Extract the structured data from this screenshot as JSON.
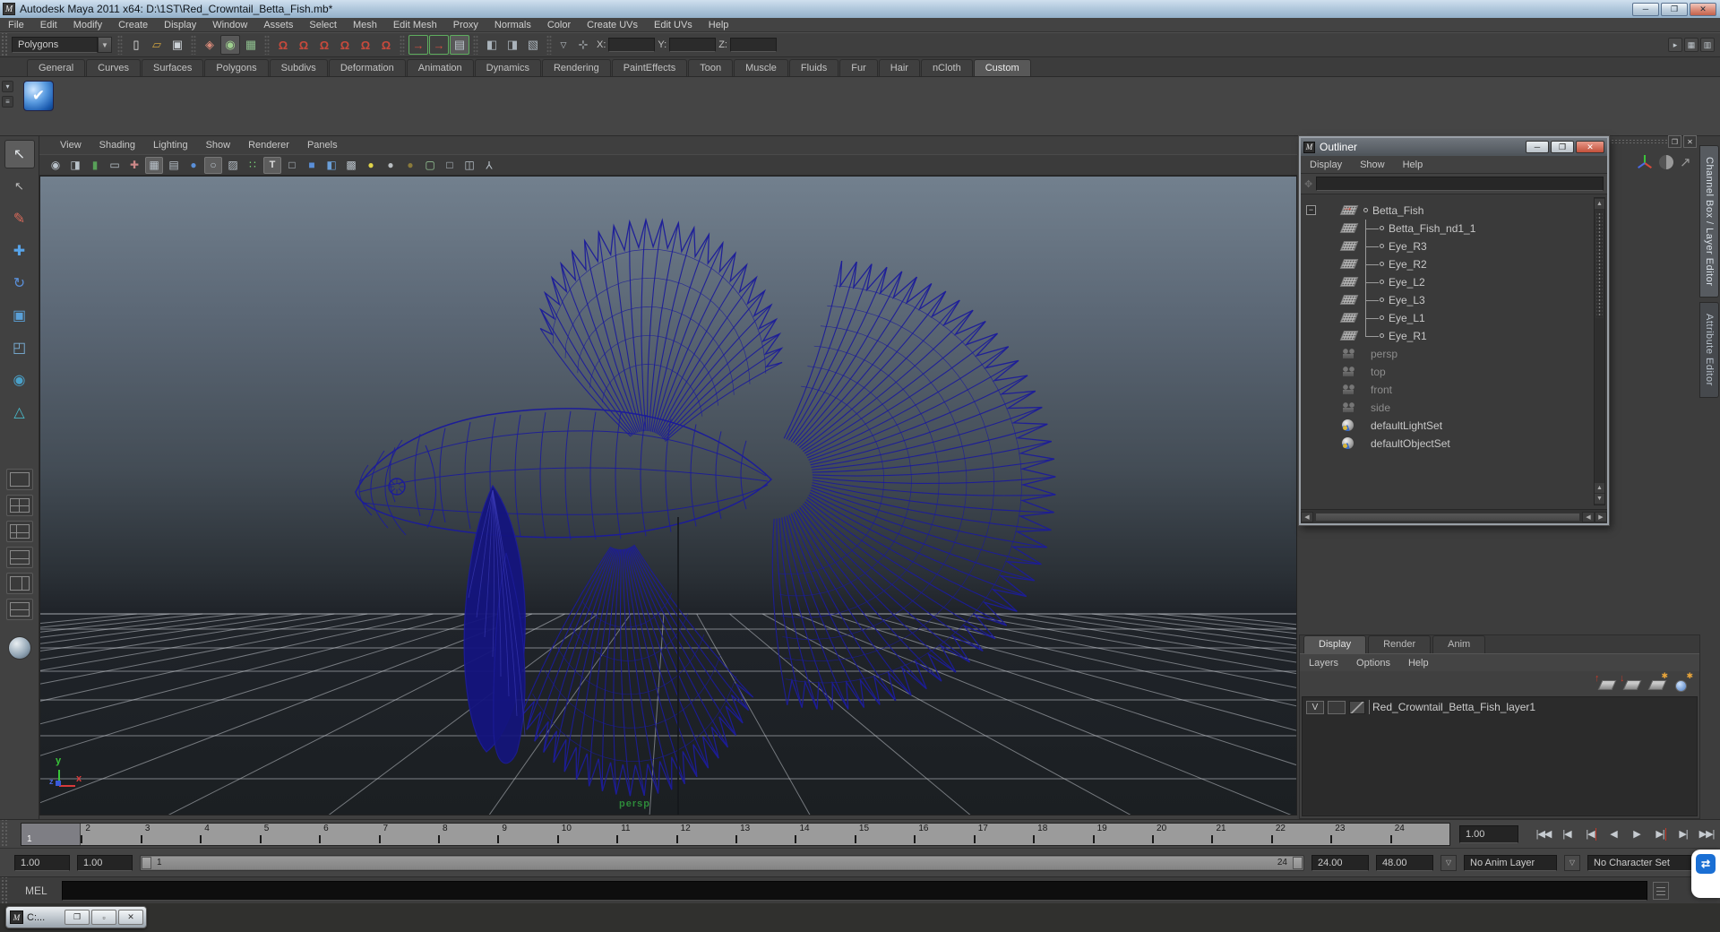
{
  "window": {
    "title": "Autodesk Maya 2011 x64: D:\\1ST\\Red_Crowntail_Betta_Fish.mb*",
    "minimize": "─",
    "maximize": "❐",
    "close": "✕"
  },
  "menubar": {
    "items": [
      "File",
      "Edit",
      "Modify",
      "Create",
      "Display",
      "Window",
      "Assets",
      "Select",
      "Mesh",
      "Edit Mesh",
      "Proxy",
      "Normals",
      "Color",
      "Create UVs",
      "Edit UVs",
      "Help"
    ]
  },
  "statusline": {
    "mode": "Polygons",
    "file_icons": [
      {
        "name": "new-scene"
      },
      {
        "name": "open-scene"
      },
      {
        "name": "save-scene"
      }
    ],
    "select_icons": [
      {
        "name": "select-hierarchy"
      },
      {
        "name": "select-object",
        "active": true
      },
      {
        "name": "select-component"
      }
    ],
    "snap_icons": [
      {
        "name": "snap-grid"
      },
      {
        "name": "snap-curve"
      },
      {
        "name": "snap-point"
      },
      {
        "name": "snap-projected-center"
      },
      {
        "name": "snap-view-plane"
      },
      {
        "name": "make-live"
      }
    ],
    "history_icons": [
      {
        "name": "input-connections"
      },
      {
        "name": "output-connections"
      },
      {
        "name": "construction-history",
        "active": true
      }
    ],
    "render_icons": [
      {
        "name": "render-current-frame"
      },
      {
        "name": "ipr-render"
      },
      {
        "name": "render-settings"
      }
    ],
    "coords": [
      {
        "label": "X:"
      },
      {
        "label": "Y:"
      },
      {
        "label": "Z:"
      }
    ]
  },
  "shelf": {
    "tabs": [
      {
        "label": "General"
      },
      {
        "label": "Curves"
      },
      {
        "label": "Surfaces"
      },
      {
        "label": "Polygons"
      },
      {
        "label": "Subdivs"
      },
      {
        "label": "Deformation"
      },
      {
        "label": "Animation"
      },
      {
        "label": "Dynamics"
      },
      {
        "label": "Rendering"
      },
      {
        "label": "PaintEffects"
      },
      {
        "label": "Toon"
      },
      {
        "label": "Muscle"
      },
      {
        "label": "Fluids"
      },
      {
        "label": "Fur"
      },
      {
        "label": "Hair"
      },
      {
        "label": "nCloth"
      },
      {
        "label": "Custom",
        "active": true
      }
    ],
    "item_check": "✔"
  },
  "toolbox": {
    "tools": [
      {
        "name": "select-tool",
        "cls": "t-select",
        "active": true
      },
      {
        "name": "lasso-select-tool",
        "cls": "t-lasso"
      },
      {
        "name": "paint-select-tool",
        "cls": "t-paint"
      },
      {
        "name": "move-tool",
        "cls": "t-move"
      },
      {
        "name": "rotate-tool",
        "cls": "t-rotate"
      },
      {
        "name": "scale-tool",
        "cls": "t-scale"
      },
      {
        "name": "universal-manipulator-tool",
        "cls": "t-univ"
      },
      {
        "name": "soft-modification-tool",
        "cls": "t-soft"
      },
      {
        "name": "show-manipulator-tool",
        "cls": "t-showman"
      }
    ],
    "layouts": [
      {
        "name": "layout-single-pane",
        "cls": "lay-single"
      },
      {
        "name": "layout-four-pane",
        "cls": "lay-four"
      },
      {
        "name": "layout-pane-left-split",
        "cls": "lay-pane-left-split"
      },
      {
        "name": "layout-pane-bottom-split",
        "cls": "lay-pane-bottom-split"
      },
      {
        "name": "layout-two-pane-side",
        "cls": "lay-two-pane-side"
      },
      {
        "name": "layout-hypergraph-persp",
        "cls": "lay-hypergraph-persp"
      }
    ]
  },
  "viewport": {
    "menus": [
      "View",
      "Shading",
      "Lighting",
      "Show",
      "Renderer",
      "Panels"
    ],
    "toolbar": [
      {
        "name": "select-camera"
      },
      {
        "name": "camera-attributes"
      },
      {
        "name": "bookmarks"
      },
      {
        "name": "image-plane"
      },
      {
        "name": "camera-manipulator"
      },
      {
        "name": "wireframe",
        "sel": true
      },
      {
        "name": "film-gate"
      },
      {
        "name": "shaded"
      },
      {
        "name": "flat-shade",
        "sel": true
      },
      {
        "name": "xray"
      },
      {
        "name": "vertex-dots"
      },
      {
        "name": "textured",
        "sel": true
      },
      {
        "name": "default-material"
      },
      {
        "name": "shaded-cube"
      },
      {
        "name": "textured-cube"
      },
      {
        "name": "checker-sphere"
      },
      {
        "name": "lighting-all"
      },
      {
        "name": "lighting-default"
      },
      {
        "name": "lighting-none"
      },
      {
        "name": "isolate-select"
      },
      {
        "name": "plugin-cube"
      },
      {
        "name": "plugin-cube2"
      },
      {
        "name": "share-view"
      }
    ],
    "camera_label": "persp",
    "axis": {
      "x": "x",
      "y": "y",
      "z": "z"
    }
  },
  "outliner": {
    "title": "Outliner",
    "buttons": {
      "minimize": "─",
      "restore": "❐",
      "close": "✕"
    },
    "menus": [
      "Display",
      "Show",
      "Help"
    ],
    "search_value": "",
    "items": [
      {
        "label": "Betta_Fish",
        "cls": "root",
        "icon": "xform"
      },
      {
        "label": "Betta_Fish_nd1_1",
        "cls": "child",
        "icon": "mesh"
      },
      {
        "label": "Eye_R3",
        "cls": "child",
        "icon": "mesh"
      },
      {
        "label": "Eye_R2",
        "cls": "child",
        "icon": "mesh"
      },
      {
        "label": "Eye_L2",
        "cls": "child",
        "icon": "mesh"
      },
      {
        "label": "Eye_L3",
        "cls": "child",
        "icon": "mesh"
      },
      {
        "label": "Eye_L1",
        "cls": "child",
        "icon": "mesh"
      },
      {
        "label": "Eye_R1",
        "cls": "child last",
        "icon": "mesh"
      },
      {
        "label": "persp",
        "cls": "plain",
        "icon": "camera",
        "grayed": true
      },
      {
        "label": "top",
        "cls": "plain",
        "icon": "camera",
        "grayed": true
      },
      {
        "label": "front",
        "cls": "plain",
        "icon": "camera",
        "grayed": true
      },
      {
        "label": "side",
        "cls": "plain",
        "icon": "camera",
        "grayed": true
      },
      {
        "label": "defaultLightSet",
        "cls": "plain",
        "icon": "set"
      },
      {
        "label": "defaultObjectSet",
        "cls": "plain",
        "icon": "set"
      }
    ]
  },
  "sidebar_tabs": [
    {
      "label": "Channel Box / Layer Editor",
      "active": true
    },
    {
      "label": "Attribute Editor"
    }
  ],
  "layer_editor": {
    "tabs": [
      {
        "label": "Display",
        "active": true
      },
      {
        "label": "Render"
      },
      {
        "label": "Anim"
      }
    ],
    "menus": [
      "Layers",
      "Options",
      "Help"
    ],
    "icons": [
      {
        "name": "move-layer-up"
      },
      {
        "name": "move-layer-down"
      },
      {
        "name": "new-empty-layer"
      },
      {
        "name": "new-layer-assign-selected"
      }
    ],
    "layers": [
      {
        "visibility": "V",
        "name": "Red_Crowntail_Betta_Fish_layer1"
      }
    ]
  },
  "timeline": {
    "frames": [
      "1",
      "2",
      "3",
      "4",
      "5",
      "6",
      "7",
      "8",
      "9",
      "10",
      "11",
      "12",
      "13",
      "14",
      "15",
      "16",
      "17",
      "18",
      "19",
      "20",
      "21",
      "22",
      "23",
      "24"
    ],
    "current_frame": "1",
    "time_field": "1.00",
    "transport": [
      {
        "name": "go-to-start",
        "glyph": "|◀◀"
      },
      {
        "name": "step-back-key",
        "glyph": "|◀"
      },
      {
        "name": "step-back-frame",
        "glyph": "|◀",
        "red": true
      },
      {
        "name": "play-backwards",
        "glyph": "◀"
      },
      {
        "name": "play-forwards",
        "glyph": "▶"
      },
      {
        "name": "step-forward-frame",
        "glyph": "▶|",
        "red": true
      },
      {
        "name": "step-forward-key",
        "glyph": "▶|"
      },
      {
        "name": "go-to-end",
        "glyph": "▶▶|"
      }
    ]
  },
  "range": {
    "anim_start": "1.00",
    "playback_start": "1.00",
    "slider_start": "1",
    "slider_end": "24",
    "playback_end": "24.00",
    "anim_end": "48.00",
    "anim_layer": "No Anim Layer",
    "character_set": "No Character Set"
  },
  "command_line": {
    "label": "MEL",
    "value": ""
  },
  "taskbar": {
    "minimized_window": "C:..."
  }
}
